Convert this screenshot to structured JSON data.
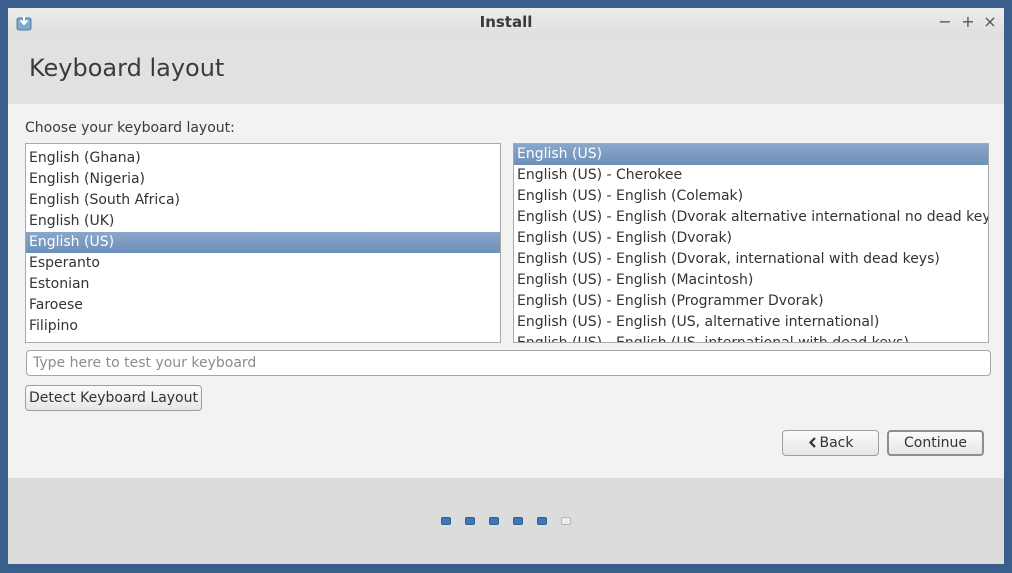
{
  "window": {
    "title": "Install",
    "minimize": "−",
    "maximize": "+",
    "close": "×"
  },
  "page": {
    "title": "Keyboard layout",
    "prompt": "Choose your keyboard layout:"
  },
  "layouts": {
    "items": [
      "English (Ghana)",
      "English (Nigeria)",
      "English (South Africa)",
      "English (UK)",
      "English (US)",
      "Esperanto",
      "Estonian",
      "Faroese",
      "Filipino"
    ],
    "selected": "English (US)"
  },
  "variants": {
    "items": [
      "English (US)",
      "English (US) - Cherokee",
      "English (US) - English (Colemak)",
      "English (US) - English (Dvorak alternative international no dead keys)",
      "English (US) - English (Dvorak)",
      "English (US) - English (Dvorak, international with dead keys)",
      "English (US) - English (Macintosh)",
      "English (US) - English (Programmer Dvorak)",
      "English (US) - English (US, alternative international)",
      "English (US) - English (US, international with dead keys)"
    ],
    "selected": "English (US)"
  },
  "test_input": {
    "placeholder": "Type here to test your keyboard",
    "value": ""
  },
  "buttons": {
    "detect": "Detect Keyboard Layout",
    "back": "Back",
    "continue": "Continue"
  },
  "progress": {
    "total_steps": 6,
    "completed_steps": 5
  },
  "colors": {
    "selection": "#7b9bc4",
    "progress_dot": "#3e76b8",
    "desktop_bg": "#3a5f8c"
  }
}
